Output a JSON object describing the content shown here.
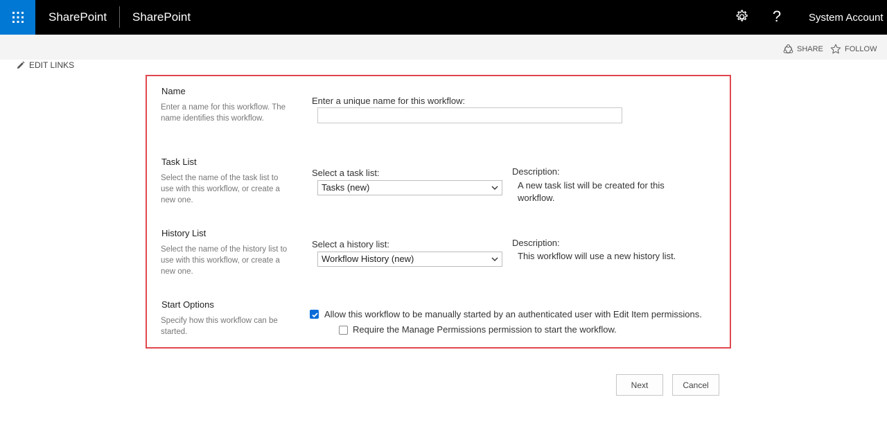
{
  "suite_bar": {
    "app_launcher_icon": "waffle-icon",
    "brand": "SharePoint",
    "site_name": "SharePoint",
    "settings_icon": "gear-icon",
    "help_label": "?",
    "account_name": "System Account",
    "colors": {
      "bar": "#000000",
      "launcher": "#0078d4"
    }
  },
  "actions": {
    "share": "SHARE",
    "follow": "FOLLOW",
    "edit_links": "EDIT LINKS"
  },
  "form": {
    "border_color": "#e0474f",
    "name_section": {
      "title": "Name",
      "description": "Enter a name for this workflow. The name identifies this workflow.",
      "field_label": "Enter a unique name for this workflow:",
      "value": ""
    },
    "task_section": {
      "title": "Task List",
      "description": "Select the name of the task list to use with this workflow, or create a new one.",
      "select_label": "Select a task list:",
      "selected": "Tasks (new)",
      "desc_label": "Description:",
      "desc_text": "A new task list will be created for this workflow."
    },
    "history_section": {
      "title": "History List",
      "description": "Select the name of the history list to use with this workflow, or create a new one.",
      "select_label": "Select a history list:",
      "selected": "Workflow History (new)",
      "desc_label": "Description:",
      "desc_text": "This workflow will use a new history list."
    },
    "start_section": {
      "title": "Start Options",
      "description": "Specify how this workflow can be started.",
      "allow_manual_label": "Allow this workflow to be manually started by an authenticated user with Edit Item permissions.",
      "allow_manual_checked": true,
      "require_manage_label": "Require the Manage Permissions permission to start the workflow.",
      "require_manage_checked": false
    }
  },
  "buttons": {
    "next": "Next",
    "cancel": "Cancel"
  }
}
